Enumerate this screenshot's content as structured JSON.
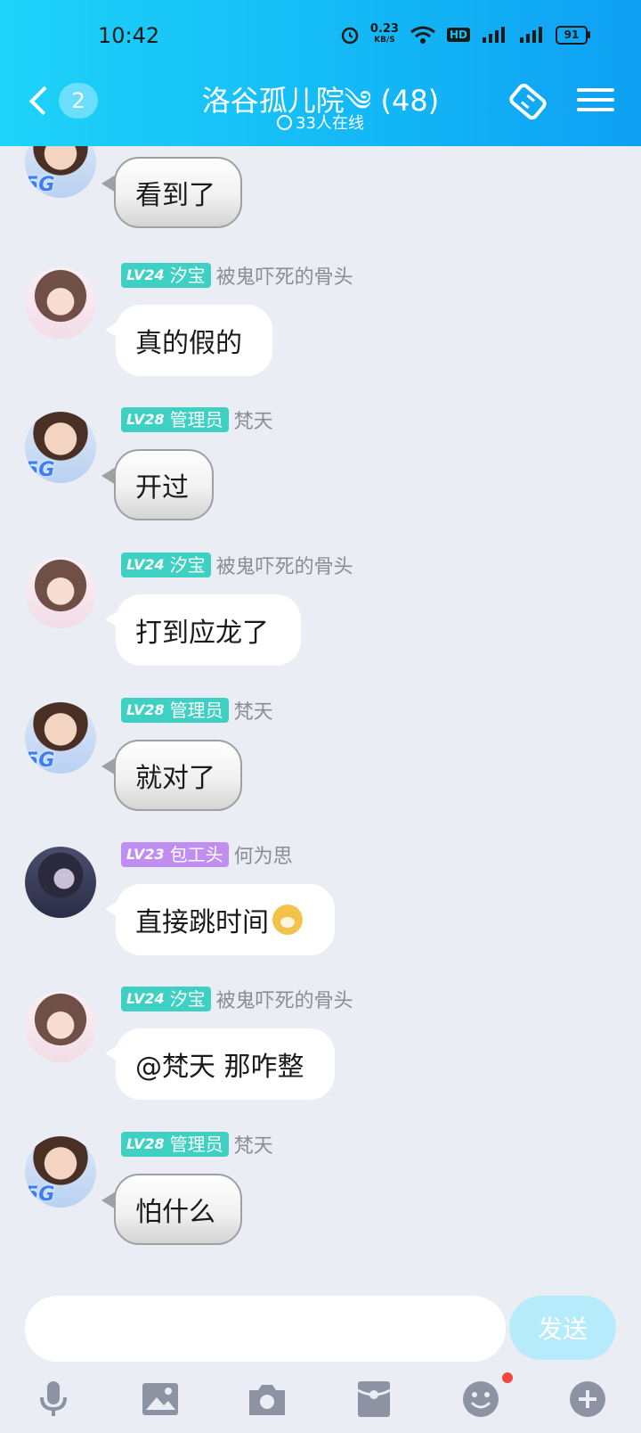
{
  "status_bar": {
    "time": "10:42",
    "net_speed": "0.23",
    "net_unit": "KB/S",
    "hd": "HD",
    "battery": "91"
  },
  "header": {
    "back_count": "2",
    "title": "洛谷孤儿院༄ (48)",
    "online": "33人在线"
  },
  "messages": [
    {
      "name": "",
      "tag_level": "",
      "tag_title": "",
      "text": "看到了",
      "avatar": "boy-avatar",
      "style": "grey"
    },
    {
      "name": "被鬼吓死的骨头",
      "tag_level": "LV24",
      "tag_title": "汐宝",
      "text": "真的假的",
      "avatar": "girl-avatar",
      "style": "white"
    },
    {
      "name": "梵天",
      "tag_level": "LV28",
      "tag_title": "管理员",
      "text": "开过",
      "avatar": "boy-avatar",
      "style": "grey"
    },
    {
      "name": "被鬼吓死的骨头",
      "tag_level": "LV24",
      "tag_title": "汐宝",
      "text": "打到应龙了",
      "avatar": "girl-avatar",
      "style": "white"
    },
    {
      "name": "梵天",
      "tag_level": "LV28",
      "tag_title": "管理员",
      "text": "就对了",
      "avatar": "boy-avatar",
      "style": "grey"
    },
    {
      "name": "何为思",
      "tag_level": "LV23",
      "tag_title": "包工头",
      "text": "直接跳时间",
      "avatar": "dark-avatar",
      "style": "white"
    },
    {
      "name": "被鬼吓死的骨头",
      "tag_level": "LV24",
      "tag_title": "汐宝",
      "text": "@梵天 那咋整",
      "avatar": "girl-avatar",
      "style": "white"
    },
    {
      "name": "梵天",
      "tag_level": "LV28",
      "tag_title": "管理员",
      "text": "怕什么",
      "avatar": "boy-avatar",
      "style": "grey"
    }
  ],
  "input": {
    "placeholder": "",
    "send_label": "发送"
  },
  "toolbar": {
    "icons": [
      "microphone-icon",
      "image-icon",
      "camera-icon",
      "red-packet-icon",
      "emoji-icon",
      "plus-icon"
    ]
  },
  "colors": {
    "header_start": "#1ed3f9",
    "header_end": "#0ea0f3",
    "tag_teal": "#3ed0c2",
    "tag_purple": "#c08df0",
    "send_bg": "#b6ebfb",
    "background": "#ebedf5"
  }
}
